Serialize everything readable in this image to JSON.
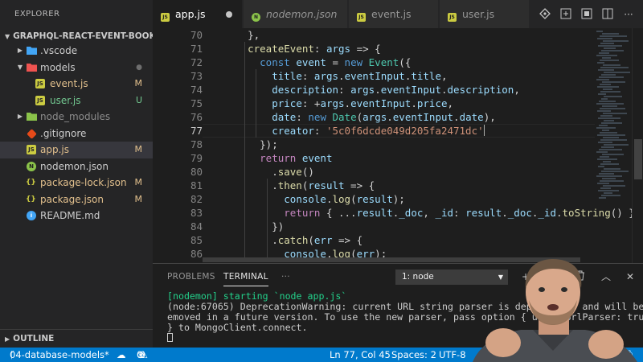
{
  "sidebar": {
    "header": "EXPLORER",
    "root_folder": "GRAPHQL-REACT-EVENT-BOOKI...",
    "tree": [
      {
        "label": ".vscode",
        "type": "folder",
        "badge": "",
        "badge_color": ""
      },
      {
        "label": "models",
        "type": "folder-open",
        "badge": "●",
        "badge_color": "#6e6e6e"
      },
      {
        "label": "event.js",
        "type": "js",
        "badge": "M",
        "badge_color": "#e2c08d"
      },
      {
        "label": "user.js",
        "type": "js",
        "badge": "U",
        "badge_color": "#73c991"
      },
      {
        "label": "node_modules",
        "type": "folder",
        "badge": "",
        "badge_color": ""
      },
      {
        "label": ".gitignore",
        "type": "git",
        "badge": "",
        "badge_color": ""
      },
      {
        "label": "app.js",
        "type": "js",
        "badge": "M",
        "badge_color": "#e2c08d"
      },
      {
        "label": "nodemon.json",
        "type": "node",
        "badge": "",
        "badge_color": ""
      },
      {
        "label": "package-lock.json",
        "type": "json",
        "badge": "M",
        "badge_color": "#e2c08d"
      },
      {
        "label": "package.json",
        "type": "json",
        "badge": "M",
        "badge_color": "#e2c08d"
      },
      {
        "label": "README.md",
        "type": "info",
        "badge": "",
        "badge_color": ""
      }
    ],
    "outline": "OUTLINE"
  },
  "tabs": [
    {
      "label": "app.js",
      "icon": "js",
      "dirty": true
    },
    {
      "label": "nodemon.json",
      "icon": "node",
      "dirty": false
    },
    {
      "label": "event.js",
      "icon": "js",
      "dirty": false
    },
    {
      "label": "user.js",
      "icon": "js",
      "dirty": false
    }
  ],
  "tab_actions": [
    "git-compare-icon",
    "open-changes-icon",
    "preview-icon",
    "split-editor-icon",
    "more-actions-icon"
  ],
  "editor": {
    "line_numbers": [
      "70",
      "71",
      "72",
      "73",
      "74",
      "75",
      "76",
      "77",
      "78",
      "79",
      "80",
      "81",
      "82",
      "83",
      "84",
      "85",
      "86"
    ],
    "current_line": "77",
    "code": [
      "    },",
      "    createEvent: args => {",
      "      const event = new Event({",
      "        title: args.eventInput.title,",
      "        description: args.eventInput.description,",
      "        price: +args.eventInput.price,",
      "        date: new Date(args.eventInput.date),",
      "        creator: '5c0f6dcde049d205fa2471dc'",
      "      });",
      "      return event",
      "        .save()",
      "        .then(result => {",
      "          console.log(result);",
      "          return { ...result._doc, _id: result._doc._id.toString() };",
      "        })",
      "        .catch(err => {",
      "          console.log(err);"
    ]
  },
  "panel": {
    "tabs": [
      "PROBLEMS",
      "TERMINAL",
      "···"
    ],
    "active_tab": "TERMINAL",
    "terminal_select": "1: node",
    "terminal_lines": [
      "[nodemon] starting `node app.js`",
      "(node:67065) DeprecationWarning: current URL string parser is deprecated, and will be r",
      "emoved in a future version. To use the new parser, pass option { useNewUrlParser: true",
      "} to MongoClient.connect."
    ]
  },
  "statusbar": {
    "branch": "04-database-models*",
    "sync": "⟳",
    "errors": "0",
    "warnings": "0",
    "position": "Ln 77, Col 45",
    "spaces": "Spaces: 2",
    "encoding": "UTF-8"
  },
  "colors": {
    "accent": "#007acc",
    "modified": "#e2c08d",
    "untracked": "#73c991"
  }
}
